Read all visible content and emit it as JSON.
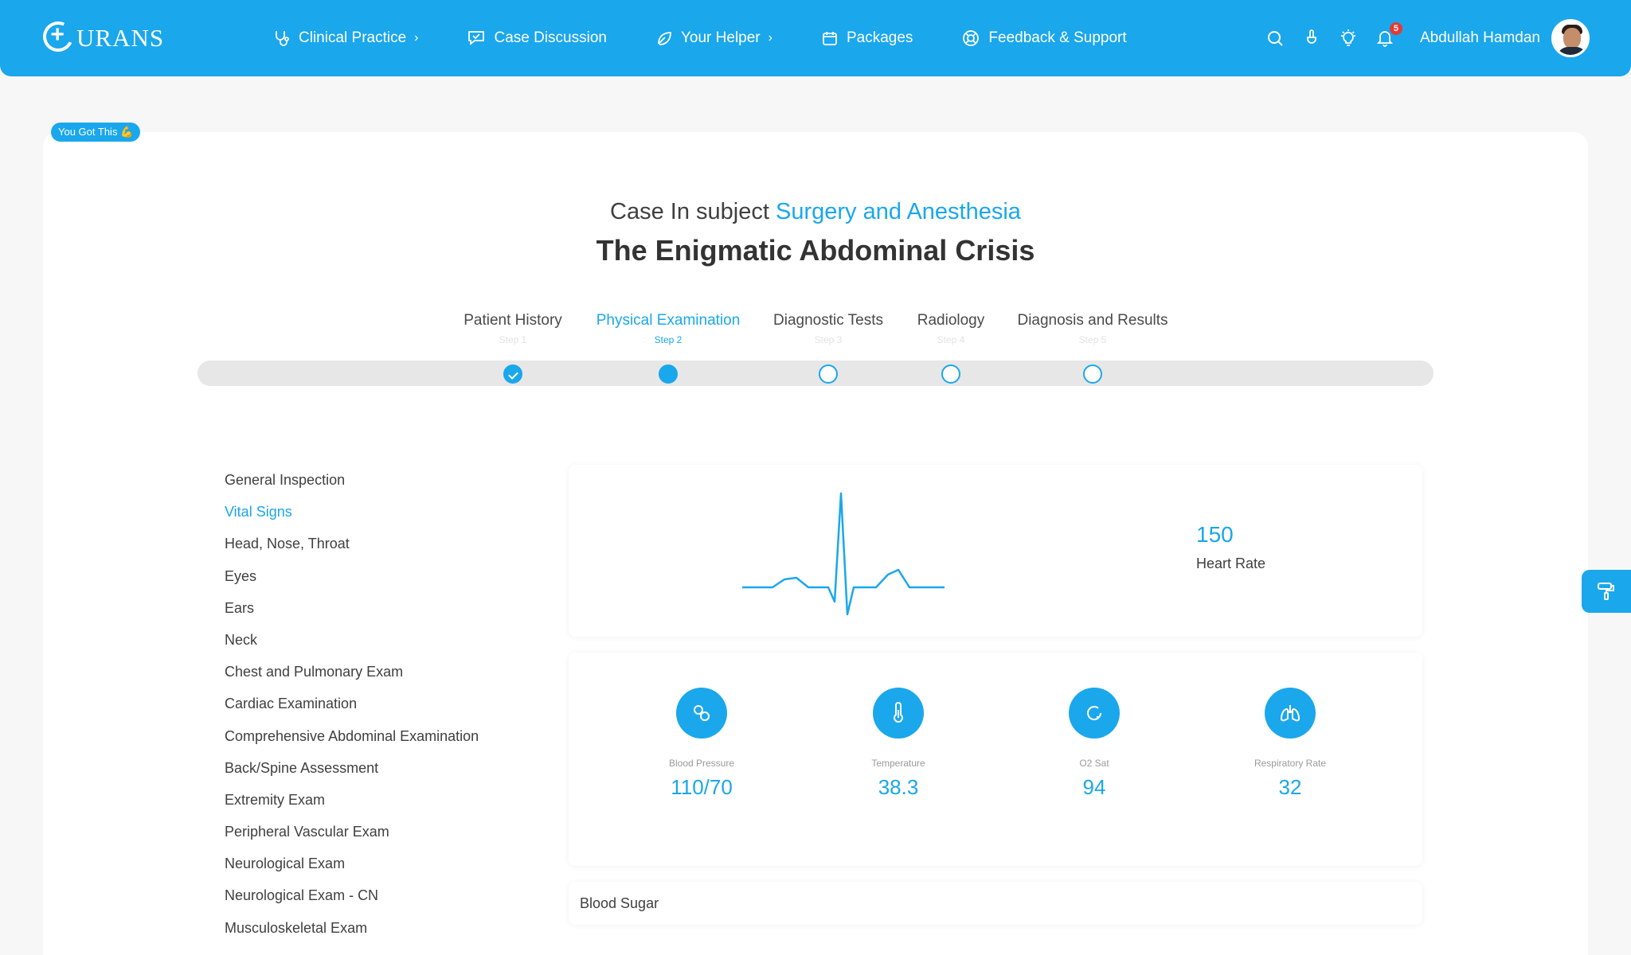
{
  "brand": {
    "name": "URANS"
  },
  "nav": [
    {
      "label": "Clinical Practice",
      "icon": "stethoscope-icon",
      "has_chevron": true
    },
    {
      "label": "Case Discussion",
      "icon": "chat-icon",
      "has_chevron": false
    },
    {
      "label": "Your Helper",
      "icon": "leaf-icon",
      "has_chevron": true
    },
    {
      "label": "Packages",
      "icon": "calendar-icon",
      "has_chevron": false
    },
    {
      "label": "Feedback & Support",
      "icon": "lifebuoy-icon",
      "has_chevron": false
    }
  ],
  "user": {
    "name": "Abdullah Hamdan",
    "notifications": "5"
  },
  "pill": {
    "label": "You Got This 💪"
  },
  "case": {
    "subject_prefix": "Case In subject",
    "subject": "Surgery and Anesthesia",
    "title": "The Enigmatic Abdominal Crisis"
  },
  "steps": [
    {
      "name": "Patient History",
      "num": "Step 1",
      "state": "done"
    },
    {
      "name": "Physical Examination",
      "num": "Step 2",
      "state": "current"
    },
    {
      "name": "Diagnostic Tests",
      "num": "Step 3",
      "state": "pending"
    },
    {
      "name": "Radiology",
      "num": "Step 4",
      "state": "pending"
    },
    {
      "name": "Diagnosis and Results",
      "num": "Step 5",
      "state": "pending"
    }
  ],
  "menu": [
    "General Inspection",
    "Vital Signs",
    "Head, Nose, Throat",
    "Eyes",
    "Ears",
    "Neck",
    "Chest and Pulmonary Exam",
    "Cardiac Examination",
    "Comprehensive Abdominal Examination",
    "Back/Spine Assessment",
    "Extremity Exam",
    "Peripheral Vascular Exam",
    "Neurological Exam",
    "Neurological Exam - CN",
    "Musculoskeletal Exam"
  ],
  "menu_active": "Vital Signs",
  "heart_rate": {
    "value": "150",
    "label": "Heart Rate"
  },
  "vitals": [
    {
      "label": "Blood Pressure",
      "value": "110/70",
      "icon": "blood-pressure-icon"
    },
    {
      "label": "Temperature",
      "value": "38.3",
      "icon": "thermometer-icon"
    },
    {
      "label": "O2 Sat",
      "value": "94",
      "icon": "oxygen-icon"
    },
    {
      "label": "Respiratory Rate",
      "value": "32",
      "icon": "lungs-icon"
    }
  ],
  "blood_sugar": {
    "label": "Blood Sugar"
  },
  "colors": {
    "accent": "#1aa7ec",
    "text": "#3f3f3f",
    "badge": "#e53935"
  }
}
